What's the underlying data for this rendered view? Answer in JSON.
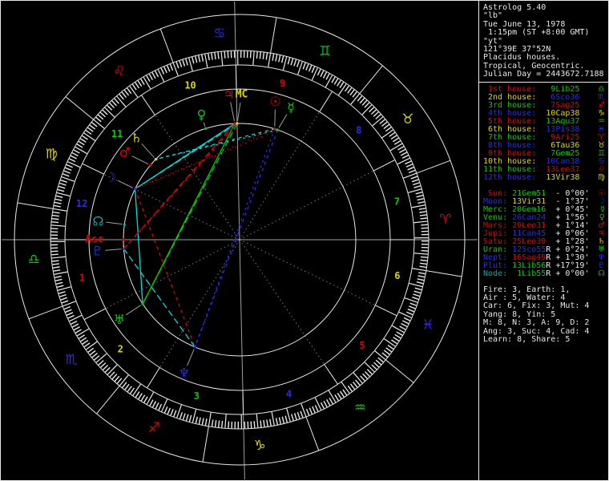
{
  "header": {
    "lines": [
      "Astrolog 5.40",
      "\"lb\"",
      "Tue June 13, 1978",
      " 1:15pm (ST +8:00 GMT)",
      "\"yt\"",
      "121°39E 37°52N",
      "Placidus houses.",
      "Tropical, Geocentric.",
      "Julian Day = 2443672.7188"
    ]
  },
  "houses": [
    {
      "label": " 1st house:",
      "value": " 9Lib25",
      "glyph": "♎",
      "element": "air"
    },
    {
      "label": " 2nd house:",
      "value": " 6Sco36",
      "glyph": "♏",
      "element": "water"
    },
    {
      "label": " 3rd house:",
      "value": " 7Sag25",
      "glyph": "♐",
      "element": "fire"
    },
    {
      "label": " 4th house:",
      "value": "10Cap38",
      "glyph": "♑",
      "element": "earth"
    },
    {
      "label": " 5th house:",
      "value": "13Aqu37",
      "glyph": "♒",
      "element": "air"
    },
    {
      "label": " 6th house:",
      "value": "13Pis38",
      "glyph": "♓",
      "element": "water"
    },
    {
      "label": " 7th house:",
      "value": " 9Ari25",
      "glyph": "♈",
      "element": "fire"
    },
    {
      "label": " 8th house:",
      "value": " 6Tau36",
      "glyph": "♉",
      "element": "earth"
    },
    {
      "label": " 9th house:",
      "value": " 7Gem25",
      "glyph": "♊",
      "element": "air"
    },
    {
      "label": "10th house:",
      "value": "10Can38",
      "glyph": "♋",
      "element": "water"
    },
    {
      "label": "11th house:",
      "value": "13Leo37",
      "glyph": "♌",
      "element": "fire"
    },
    {
      "label": "12th house:",
      "value": "13Vir38",
      "glyph": "♍",
      "element": "earth"
    }
  ],
  "house_label_colors": [
    "red",
    "yellow",
    "green",
    "blue"
  ],
  "planet_rows": [
    {
      "label": " Sun:",
      "value": "21Gem51",
      "retro": "",
      "delta": "- 0°00'",
      "glyph": "☉",
      "label_color": "red",
      "value_color": "air",
      "glyph_color": "red"
    },
    {
      "label": "Moon:",
      "value": "13Vir31",
      "retro": "",
      "delta": "- 1°37'",
      "glyph": "☽",
      "label_color": "blue",
      "value_color": "earth",
      "glyph_color": "blue"
    },
    {
      "label": "Merc:",
      "value": "20Gem16",
      "retro": "",
      "delta": "+ 0°45'",
      "glyph": "☿",
      "label_color": "green",
      "value_color": "air",
      "glyph_color": "green"
    },
    {
      "label": "Venu:",
      "value": "26Can24",
      "retro": "",
      "delta": "+ 1°56'",
      "glyph": "♀",
      "label_color": "green",
      "value_color": "water",
      "glyph_color": "green"
    },
    {
      "label": "Mars:",
      "value": "29Leo31",
      "retro": "",
      "delta": "+ 1°14'",
      "glyph": "♂",
      "label_color": "red",
      "value_color": "fire",
      "glyph_color": "red"
    },
    {
      "label": "Jupi:",
      "value": "11Can45",
      "retro": "",
      "delta": "+ 0°06'",
      "glyph": "♃",
      "label_color": "red",
      "value_color": "water",
      "glyph_color": "red"
    },
    {
      "label": "Satu:",
      "value": "25Leo39",
      "retro": "",
      "delta": "+ 1°28'",
      "glyph": "♄",
      "label_color": "red",
      "value_color": "fire",
      "glyph_color": "yellow"
    },
    {
      "label": "Uran:",
      "value": "12Sco55",
      "retro": "R",
      "delta": "+ 0°24'",
      "glyph": "♅",
      "label_color": "green",
      "value_color": "water",
      "glyph_color": "green"
    },
    {
      "label": "Nept:",
      "value": "16Sag49",
      "retro": "R",
      "delta": "+ 1°30'",
      "glyph": "♆",
      "label_color": "blue",
      "value_color": "fire",
      "glyph_color": "blue"
    },
    {
      "label": "Plut:",
      "value": "13Lib56",
      "retro": "R",
      "delta": "+17°19'",
      "glyph": "♇",
      "label_color": "blue",
      "value_color": "air",
      "glyph_color": "blue"
    },
    {
      "label": "Node:",
      "value": " 1Lib55",
      "retro": "R",
      "delta": "+ 0°00'",
      "glyph": "☊",
      "label_color": "teal",
      "value_color": "air",
      "glyph_color": "teal"
    }
  ],
  "stats": [
    "Fire: 3, Earth: 1,",
    "Air : 5, Water: 4",
    "Car: 6, Fix: 3, Mut: 4",
    "Yang: 8, Yin: 5",
    "M: 8, N: 3, A: 9, D: 2",
    "Ang: 3, Suc: 4, Cad: 4",
    "Learn: 8, Share: 5"
  ],
  "chart_data": {
    "type": "astrology-wheel",
    "title": "Natal wheel chart, Placidus houses, Tropical, Geocentric",
    "ascendant_lon": 189.417,
    "midheaven_lon": 100.633,
    "house_cusps_lon": [
      189.417,
      216.6,
      247.417,
      280.633,
      313.617,
      343.633,
      9.417,
      36.6,
      67.417,
      100.633,
      133.617,
      163.633
    ],
    "signs": [
      {
        "name": "Aries",
        "glyph": "♈",
        "element": "fire"
      },
      {
        "name": "Taurus",
        "glyph": "♉",
        "element": "earth"
      },
      {
        "name": "Gemini",
        "glyph": "♊",
        "element": "air"
      },
      {
        "name": "Cancer",
        "glyph": "♋",
        "element": "water"
      },
      {
        "name": "Leo",
        "glyph": "♌",
        "element": "fire"
      },
      {
        "name": "Virgo",
        "glyph": "♍",
        "element": "earth"
      },
      {
        "name": "Libra",
        "glyph": "♎",
        "element": "air"
      },
      {
        "name": "Scorpio",
        "glyph": "♏",
        "element": "water"
      },
      {
        "name": "Sagittarius",
        "glyph": "♐",
        "element": "fire"
      },
      {
        "name": "Capricorn",
        "glyph": "♑",
        "element": "earth"
      },
      {
        "name": "Aquarius",
        "glyph": "♒",
        "element": "air"
      },
      {
        "name": "Pisces",
        "glyph": "♓",
        "element": "water"
      }
    ],
    "planets": [
      {
        "name": "Sun",
        "glyph": "☉",
        "lon": 81.85,
        "color": "red",
        "lr": 178,
        "la": 75.5
      },
      {
        "name": "Moon",
        "glyph": "☽",
        "lon": 163.517,
        "color": "blue",
        "lr": 179
      },
      {
        "name": "Mercury",
        "glyph": "☿",
        "lon": 80.267,
        "color": "green",
        "lr": 177,
        "la": 68.8
      },
      {
        "name": "Venus",
        "glyph": "♀",
        "lon": 116.4,
        "color": "green",
        "lr": 163
      },
      {
        "name": "Mars",
        "glyph": "♂",
        "lon": 149.517,
        "color": "red",
        "lr": 180,
        "la": 142.8
      },
      {
        "name": "Jupiter",
        "glyph": "♃",
        "lon": 101.75,
        "color": "red",
        "lr": 182,
        "la": 94.2
      },
      {
        "name": "Saturn",
        "glyph": "♄",
        "lon": 145.65,
        "color": "yellow",
        "lr": 181,
        "la": 135.4
      },
      {
        "name": "Uranus",
        "glyph": "♅",
        "lon": 222.917,
        "color": "green",
        "lr": 180
      },
      {
        "name": "Neptune",
        "glyph": "♆",
        "lon": 256.817,
        "color": "blue",
        "lr": 180
      },
      {
        "name": "Pluto",
        "glyph": "♇",
        "lon": 193.933,
        "color": "blue",
        "lr": 178
      },
      {
        "name": "Node",
        "glyph": "☊",
        "lon": 181.917,
        "color": "teal",
        "lr": 178
      },
      {
        "name": "MC",
        "glyph": "MC",
        "text": true,
        "lon": 100.633,
        "color": "yellow",
        "lr": 181,
        "la": 89.2
      },
      {
        "name": "Asc",
        "glyph": "Asc",
        "text": true,
        "lon": 189.417,
        "color": "red",
        "lr": 181,
        "la": 180
      }
    ],
    "aspects": [
      {
        "a": "Sun",
        "b": "Mercury",
        "type": "conjunction",
        "orb": 1.6
      },
      {
        "a": "Jupiter",
        "b": "MC",
        "type": "conjunction",
        "orb": 1.1
      },
      {
        "a": "Mars",
        "b": "Saturn",
        "type": "conjunction",
        "orb": 3.9
      },
      {
        "a": "Asc",
        "b": "Pluto",
        "type": "conjunction",
        "orb": 4.5
      },
      {
        "a": "Moon",
        "b": "Jupiter",
        "type": "sextile",
        "orb": 1.8
      },
      {
        "a": "Moon",
        "b": "Uranus",
        "type": "sextile",
        "orb": 0.6
      },
      {
        "a": "Moon",
        "b": "MC",
        "type": "sextile",
        "orb": 2.9
      },
      {
        "a": "Sun",
        "b": "Saturn",
        "type": "sextile",
        "orb": 3.8
      },
      {
        "a": "Mercury",
        "b": "Saturn",
        "type": "sextile",
        "orb": 5.4
      },
      {
        "a": "Neptune",
        "b": "Pluto",
        "type": "sextile",
        "orb": 2.9
      },
      {
        "a": "Jupiter",
        "b": "Uranus",
        "type": "trine",
        "orb": 1.2
      },
      {
        "a": "MC",
        "b": "Uranus",
        "type": "trine",
        "orb": 2.3
      },
      {
        "a": "Moon",
        "b": "Neptune",
        "type": "square",
        "orb": 3.3
      },
      {
        "a": "Jupiter",
        "b": "Pluto",
        "type": "square",
        "orb": 2.2
      },
      {
        "a": "MC",
        "b": "Pluto",
        "type": "square",
        "orb": 3.3
      },
      {
        "a": "Sun",
        "b": "Moon",
        "type": "square",
        "orb": 8.2
      },
      {
        "a": "Mercury",
        "b": "Moon",
        "type": "square",
        "orb": 6.8
      },
      {
        "a": "Sun",
        "b": "Neptune",
        "type": "opposition",
        "orb": 5.0
      },
      {
        "a": "Mercury",
        "b": "Neptune",
        "type": "opposition",
        "orb": 3.5
      }
    ],
    "aspect_colors": {
      "conjunction": "yellow",
      "sextile": "cyan",
      "square": "red",
      "trine": "green",
      "opposition": "blue"
    },
    "colors": {
      "red": "#e00000",
      "yellow": "#ddd600",
      "green": "#00cd00",
      "blue": "#2a2af0",
      "cyan": "#00dcdc",
      "teal": "#00a8a8",
      "white": "#e8e8e8",
      "gray": "#a0a0a0",
      "dkgray": "#7a7a7a",
      "fire": "#e00000",
      "earth": "#ddd600",
      "air": "#00cd00",
      "water": "#2a2af0"
    }
  }
}
